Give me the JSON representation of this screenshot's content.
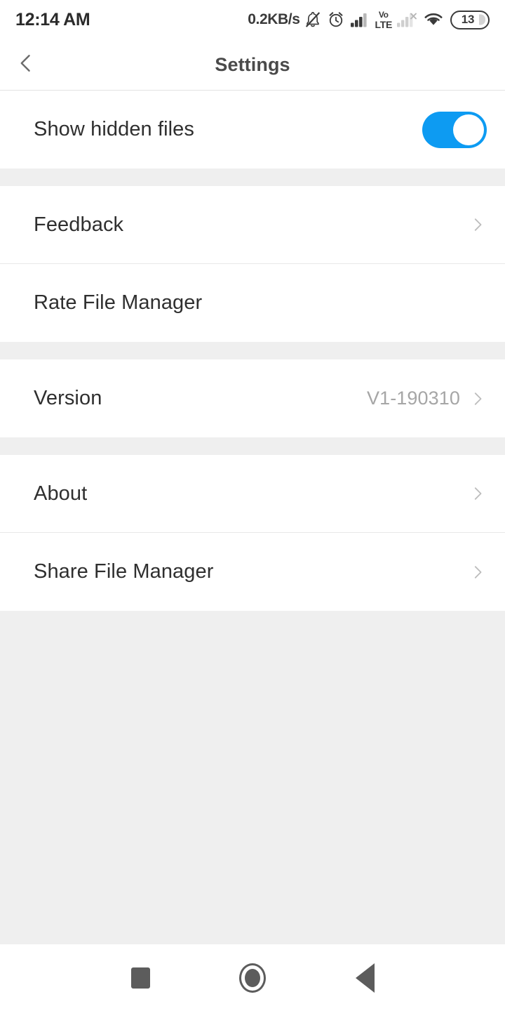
{
  "status_bar": {
    "clock": "12:14 AM",
    "network_speed": "0.2KB/s",
    "icons": [
      "bell-muted-icon",
      "alarm-clock-icon",
      "signal-bars-full-icon",
      "volte-icon",
      "signal-bars-no-service-icon",
      "wifi-icon"
    ],
    "volte_top": "Vo",
    "volte_bottom": "LTE",
    "battery_level": "13"
  },
  "header": {
    "title": "Settings",
    "back_icon": "chevron-left-icon"
  },
  "sections": [
    {
      "rows": [
        {
          "label": "Show hidden files",
          "type": "toggle",
          "toggle_on": true,
          "value": "",
          "chevron": false
        }
      ]
    },
    {
      "rows": [
        {
          "label": "Feedback",
          "type": "link",
          "toggle_on": false,
          "value": "",
          "chevron": true
        },
        {
          "label": "Rate File Manager",
          "type": "link",
          "toggle_on": false,
          "value": "",
          "chevron": false
        }
      ]
    },
    {
      "rows": [
        {
          "label": "Version",
          "type": "value",
          "toggle_on": false,
          "value": "V1-190310",
          "chevron": true
        }
      ]
    },
    {
      "rows": [
        {
          "label": "About",
          "type": "link",
          "toggle_on": false,
          "value": "",
          "chevron": true
        },
        {
          "label": "Share File Manager",
          "type": "link",
          "toggle_on": false,
          "value": "",
          "chevron": true
        }
      ]
    }
  ],
  "nav_bar": {
    "recents_label": "recents-square-icon",
    "home_label": "home-circle-icon",
    "back_label": "back-triangle-icon"
  },
  "colors": {
    "toggle_on": "#0d9bf2",
    "page_background": "#efefef",
    "row_background": "#ffffff",
    "title_text": "#4a4a4a",
    "label_text": "#2f2f2f",
    "value_text": "#a6a6a6",
    "nav_icon": "#5c5c5c"
  }
}
